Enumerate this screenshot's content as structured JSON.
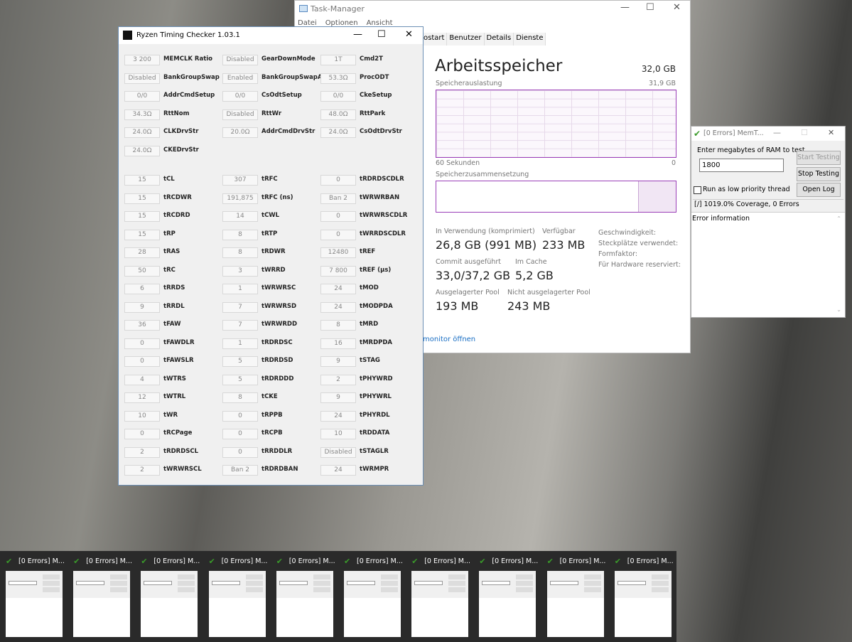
{
  "task_manager": {
    "title": "Task-Manager",
    "menu": [
      "Datei",
      "Optionen",
      "Ansicht"
    ],
    "tabs": [
      "ostart",
      "Benutzer",
      "Details",
      "Dienste"
    ],
    "heading": "Arbeitsspeicher",
    "total": "32,0 GB",
    "usage_label": "Speicherauslastung",
    "usage_max": "31,9 GB",
    "time_left": "60 Sekunden",
    "time_right": "0",
    "composition_label": "Speicherzusammensetzung",
    "stats": [
      {
        "label": "In Verwendung (komprimiert)",
        "value": "26,8 GB (991 MB)"
      },
      {
        "label": "Verfügbar",
        "value": "233 MB"
      },
      {
        "label": "Commit ausgeführt",
        "value": "33,0/37,2 GB"
      },
      {
        "label": "Im Cache",
        "value": "5,2 GB"
      },
      {
        "label": "Ausgelagerter Pool",
        "value": "193 MB"
      },
      {
        "label": "Nicht ausgelagerter Pool",
        "value": "243 MB"
      }
    ],
    "side_labels": [
      "Geschwindigkeit:",
      "Steckplätze verwendet:",
      "Formfaktor:",
      "Für Hardware reserviert:"
    ],
    "link": "monitor öffnen",
    "accent": "#9b3fb8"
  },
  "rtc": {
    "title": "Ryzen Timing Checker 1.03.1",
    "group1": [
      [
        [
          "3 200",
          "MEMCLK Ratio"
        ],
        [
          "Disabled",
          "GearDownMode"
        ],
        [
          "1T",
          "Cmd2T"
        ]
      ],
      [
        [
          "Disabled",
          "BankGroupSwap"
        ],
        [
          "Enabled",
          "BankGroupSwapAlt"
        ],
        [
          "53.3Ω",
          "ProcODT"
        ]
      ],
      [
        [
          "0/0",
          "AddrCmdSetup"
        ],
        [
          "0/0",
          "CsOdtSetup"
        ],
        [
          "0/0",
          "CkeSetup"
        ]
      ],
      [
        [
          "34.3Ω",
          "RttNom"
        ],
        [
          "Disabled",
          "RttWr"
        ],
        [
          "48.0Ω",
          "RttPark"
        ]
      ],
      [
        [
          "24.0Ω",
          "CLKDrvStr"
        ],
        [
          "20.0Ω",
          "AddrCmdDrvStr"
        ],
        [
          "24.0Ω",
          "CsOdtDrvStr"
        ]
      ],
      [
        [
          "24.0Ω",
          "CKEDrvStr"
        ]
      ]
    ],
    "group2": [
      [
        [
          "15",
          "tCL"
        ],
        [
          "307",
          "tRFC"
        ],
        [
          "0",
          "tRDRDSCDLR"
        ]
      ],
      [
        [
          "15",
          "tRCDWR"
        ],
        [
          "191,875",
          "tRFC (ns)"
        ],
        [
          "Ban 2",
          "tWRWRBAN"
        ]
      ],
      [
        [
          "15",
          "tRCDRD"
        ],
        [
          "14",
          "tCWL"
        ],
        [
          "0",
          "tWRWRSCDLR"
        ]
      ],
      [
        [
          "15",
          "tRP"
        ],
        [
          "8",
          "tRTP"
        ],
        [
          "0",
          "tWRRDSCDLR"
        ]
      ],
      [
        [
          "28",
          "tRAS"
        ],
        [
          "8",
          "tRDWR"
        ],
        [
          "12480",
          "tREF"
        ]
      ],
      [
        [
          "50",
          "tRC"
        ],
        [
          "3",
          "tWRRD"
        ],
        [
          "7 800",
          "tREF (µs)"
        ]
      ],
      [
        [
          "6",
          "tRRDS"
        ],
        [
          "1",
          "tWRWRSC"
        ],
        [
          "24",
          "tMOD"
        ]
      ],
      [
        [
          "9",
          "tRRDL"
        ],
        [
          "7",
          "tWRWRSD"
        ],
        [
          "24",
          "tMODPDA"
        ]
      ],
      [
        [
          "36",
          "tFAW"
        ],
        [
          "7",
          "tWRWRDD"
        ],
        [
          "8",
          "tMRD"
        ]
      ],
      [
        [
          "0",
          "tFAWDLR"
        ],
        [
          "1",
          "tRDRDSC"
        ],
        [
          "16",
          "tMRDPDA"
        ]
      ],
      [
        [
          "0",
          "tFAWSLR"
        ],
        [
          "5",
          "tRDRDSD"
        ],
        [
          "9",
          "tSTAG"
        ]
      ],
      [
        [
          "4",
          "tWTRS"
        ],
        [
          "5",
          "tRDRDDD"
        ],
        [
          "2",
          "tPHYWRD"
        ]
      ],
      [
        [
          "12",
          "tWTRL"
        ],
        [
          "8",
          "tCKE"
        ],
        [
          "9",
          "tPHYWRL"
        ]
      ],
      [
        [
          "10",
          "tWR"
        ],
        [
          "0",
          "tRPPB"
        ],
        [
          "24",
          "tPHYRDL"
        ]
      ],
      [
        [
          "0",
          "tRCPage"
        ],
        [
          "0",
          "tRCPB"
        ],
        [
          "10",
          "tRDDATA"
        ]
      ],
      [
        [
          "2",
          "tRDRDSCL"
        ],
        [
          "0",
          "tRRDDLR"
        ],
        [
          "Disabled",
          "tSTAGLR"
        ]
      ],
      [
        [
          "2",
          "tWRWRSCL"
        ],
        [
          "Ban 2",
          "tRDRDBAN"
        ],
        [
          "24",
          "tWRMPR"
        ]
      ]
    ]
  },
  "memtest": {
    "title": "[0 Errors] MemT...",
    "prompt": "Enter megabytes of RAM to test",
    "input": "1800",
    "start": "Start Testing",
    "stop": "Stop Testing",
    "low_priority": "Run as low priority thread",
    "open_log": "Open Log",
    "status": "[/]   1019.0% Coverage, 0 Errors",
    "error_info": "Error information"
  },
  "taskbar": {
    "items": [
      "[0 Errors] M...",
      "[0 Errors] M...",
      "[0 Errors] M...",
      "[0 Errors] M...",
      "[0 Errors] M...",
      "[0 Errors] M...",
      "[0 Errors] M...",
      "[0 Errors] M...",
      "[0 Errors] M...",
      "[0 Errors] M..."
    ]
  }
}
